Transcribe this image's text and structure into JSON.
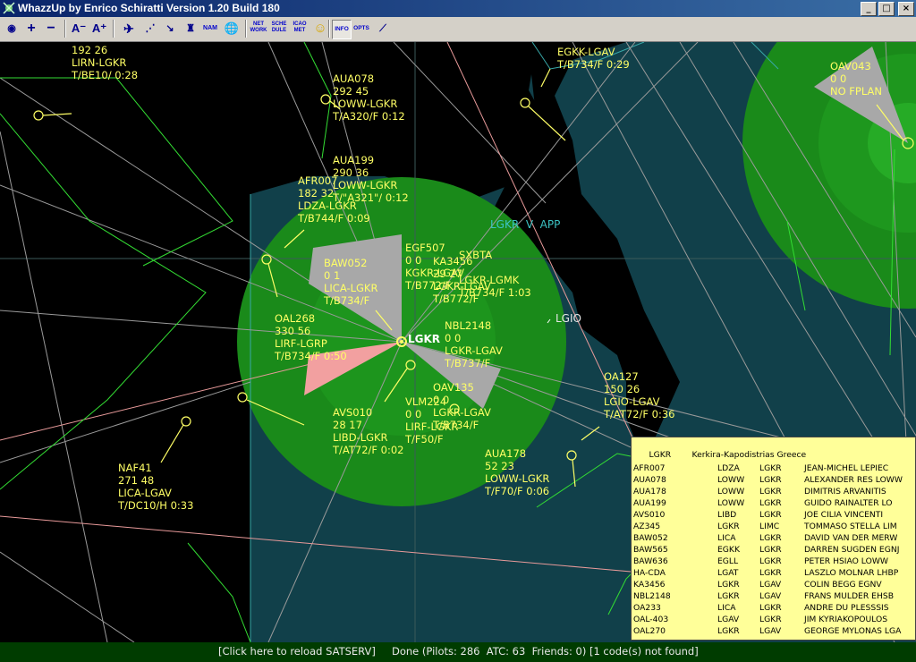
{
  "window": {
    "title": "WhazzUp by Enrico Schiratti Version 1.20 Build 180",
    "min": "_",
    "max": "□",
    "close": "×"
  },
  "toolbar": {
    "buttons": [
      {
        "name": "globe-icon",
        "glyph": "◉"
      },
      {
        "name": "zoom-in-icon",
        "glyph": "+"
      },
      {
        "name": "zoom-out-icon",
        "glyph": "−"
      },
      {
        "name": "font-smaller-icon",
        "glyph": "A⁻"
      },
      {
        "name": "font-larger-icon",
        "glyph": "A⁺"
      },
      {
        "name": "airplane-icon",
        "glyph": "✈"
      },
      {
        "name": "dotted-area-icon",
        "glyph": "⋰"
      },
      {
        "name": "route-icon",
        "glyph": "↘"
      },
      {
        "name": "tower-icon",
        "glyph": "♜"
      },
      {
        "name": "nam-button",
        "text": "NAM"
      },
      {
        "name": "world-icon",
        "glyph": "🌐"
      },
      {
        "name": "network-button",
        "text": "NET WORK"
      },
      {
        "name": "schedule-button",
        "text": "SCHE DULE"
      },
      {
        "name": "icao-met-button",
        "text": "ICAO MET"
      },
      {
        "name": "smiley-icon",
        "glyph": "☺"
      },
      {
        "name": "info-button",
        "text": "INFO"
      },
      {
        "name": "options-button",
        "text": "OPTS"
      },
      {
        "name": "runway-icon",
        "glyph": "⟋"
      }
    ]
  },
  "map": {
    "flights": [
      {
        "id": "lbl-lirn",
        "text": "192 26\nLIRN-LGKR\nT/BE10/ 0:28"
      },
      {
        "id": "lbl-aua078",
        "text": "AUA078\n292 45\nLOWW-LGKR\nT/A320/F 0:12"
      },
      {
        "id": "lbl-aua199",
        "text": "AUA199\n290 36\nLOWW-LGKR\nT/\"A321\"/ 0:12"
      },
      {
        "id": "lbl-afr007",
        "text": "AFR007\n182 32\nLDZA-LGKR\nT/B744/F 0:09"
      },
      {
        "id": "lbl-egkk",
        "text": "EGKK-LGAV\nT/B734/F 0:29"
      },
      {
        "id": "lbl-oav043",
        "text": "OAV043\n0 0\nNO FPLAN"
      },
      {
        "id": "lbl-baw052",
        "text": "BAW052\n0 1\nLICA-LGKR\nT/B734/F"
      },
      {
        "id": "lbl-egf507",
        "text": "EGF507\n0 0\nKGKR-LGAV\nT/B772/F"
      },
      {
        "id": "lbl-ka3456",
        "text": "KA3456\n29 27\nLGKR-LGAV\nT/B772/F"
      },
      {
        "id": "lbl-sxbta",
        "text": "SXBTA\n\nLGKR-LGMK\nT/B734/F 1:03"
      },
      {
        "id": "lbl-oal268",
        "text": "OAL268\n330 56\nLIRF-LGRP\nT/B734/F 0:50"
      },
      {
        "id": "lbl-nbl2148",
        "text": "NBL2148\n0 0\nLGKR-LGAV\nT/B737/F"
      },
      {
        "id": "lbl-oav135",
        "text": "OAV135\n0 0\nLGKR-LGAV\nT/B734/F"
      },
      {
        "id": "lbl-vlm",
        "text": "VLM224\n0 0\nLIRF-LGKR\nT/F50/F"
      },
      {
        "id": "lbl-avs010",
        "text": "AVS010\n28 17\nLIBD-LGKR\nT/AT72/F 0:02"
      },
      {
        "id": "lbl-oa127",
        "text": "OA127\n150 26\nLGIO-LGAV\nT/AT72/F 0:36"
      },
      {
        "id": "lbl-aua178",
        "text": "AUA178\n52 23\nLOWW-LGKR\nT/F70/F 0:06"
      },
      {
        "id": "lbl-naf41",
        "text": "NAF41\n271 48\nLICA-LGAV\nT/DC10/H 0:33"
      }
    ],
    "atc_label": "LGKR  V  APP",
    "airport_label": "LGKR",
    "waypoint_label": "LGIO"
  },
  "info_panel": {
    "icao": "LGKR",
    "name": "Kerkira-Kapodistrias Greece",
    "rows": [
      [
        "AFR007",
        "LDZA",
        "LGKR",
        "JEAN-MICHEL LEPIEC"
      ],
      [
        "AUA078",
        "LOWW",
        "LGKR",
        "ALEXANDER RES LOWW"
      ],
      [
        "AUA178",
        "LOWW",
        "LGKR",
        "DIMITRIS ARVANITIS"
      ],
      [
        "AUA199",
        "LOWW",
        "LGKR",
        "GUIDO RAINALTER LO"
      ],
      [
        "AVS010",
        "LIBD",
        "LGKR",
        "JOE CILIA VINCENTI"
      ],
      [
        "AZ345",
        "LGKR",
        "LIMC",
        "TOMMASO STELLA LIM"
      ],
      [
        "BAW052",
        "LICA",
        "LGKR",
        "DAVID VAN DER MERW"
      ],
      [
        "BAW565",
        "EGKK",
        "LGKR",
        "DARREN SUGDEN EGNJ"
      ],
      [
        "BAW636",
        "EGLL",
        "LGKR",
        "PETER HSIAO LOWW"
      ],
      [
        "HA-CDA",
        "LGAT",
        "LGKR",
        "LASZLO MOLNAR LHBP"
      ],
      [
        "KA3456",
        "LGKR",
        "LGAV",
        "COLIN BEGG EGNV"
      ],
      [
        "NBL2148",
        "LGKR",
        "LGAV",
        "FRANS MULDER EHSB"
      ],
      [
        "OA233",
        "LICA",
        "LGKR",
        "ANDRE DU PLESSSIS"
      ],
      [
        "OAL-403",
        "LGAV",
        "LGKR",
        "JIM KYRIAKOPOULOS"
      ],
      [
        "OAL270",
        "LGKR",
        "LGAV",
        "GEORGE MYLONAS LGA"
      ]
    ]
  },
  "status": {
    "reload": "[Click here to reload SATSERV]",
    "message": "Done (Pilots: 286  ATC: 63  Friends: 0) [1 code(s) not found]"
  }
}
